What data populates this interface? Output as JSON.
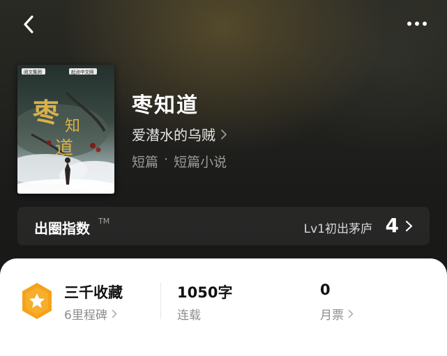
{
  "book": {
    "title": "枣知道",
    "author": "爱潜水的乌贼",
    "genre": [
      "短篇",
      "·",
      "短篇小说"
    ],
    "cover": {
      "publisher_logo": "阅文集团",
      "imprint_logo": "起点中文网",
      "cover_title": "枣知道"
    }
  },
  "index": {
    "title": "出圈指数",
    "tm": "TM",
    "level": "Lv1初出茅庐",
    "value": "4"
  },
  "stats": [
    {
      "main": "三千收藏",
      "sub": "6里程碑"
    },
    {
      "main": "1050字",
      "sub": "连载"
    },
    {
      "main": "0",
      "sub": "月票"
    }
  ],
  "icons": {
    "back": "chevron-left-icon",
    "more": "more-dots-icon",
    "badge": "star-hexagon-badge-icon"
  },
  "colors": {
    "badge": "#f5a21b",
    "background": "#1c1c1c",
    "card": "#ffffff"
  }
}
